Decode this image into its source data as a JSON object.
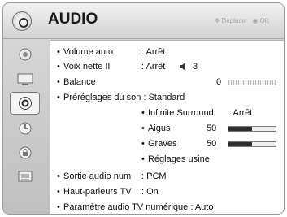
{
  "header": {
    "title": "AUDIO",
    "hint_move": "Déplacer",
    "hint_ok": "OK"
  },
  "sidebar": {
    "icons": [
      "picture-icon",
      "display-icon",
      "audio-icon",
      "clock-icon",
      "lock-icon",
      "options-icon"
    ],
    "active_index": 2
  },
  "menu": {
    "volume_auto": {
      "label": "Volume auto",
      "value": ": Arrêt"
    },
    "voix_nette": {
      "label": "Voix nette II",
      "value": ": Arrêt",
      "level": "3"
    },
    "balance": {
      "label": "Balance",
      "value": "0"
    },
    "preset": {
      "label": "Préréglages du son : Standard"
    },
    "surround": {
      "label": "Infinite Surround",
      "value": ": Arrêt"
    },
    "aigus": {
      "label": "Aigus",
      "value": "50",
      "level": 0.5
    },
    "graves": {
      "label": "Graves",
      "value": "50",
      "level": 0.5
    },
    "reset": {
      "label": "Réglages usine"
    },
    "sortie": {
      "label": "Sortie audio num",
      "value": ": PCM"
    },
    "hp": {
      "label": "Haut-parleurs TV",
      "value": ": On"
    },
    "param": {
      "label": "Paramètre audio TV numérique : Auto"
    }
  }
}
